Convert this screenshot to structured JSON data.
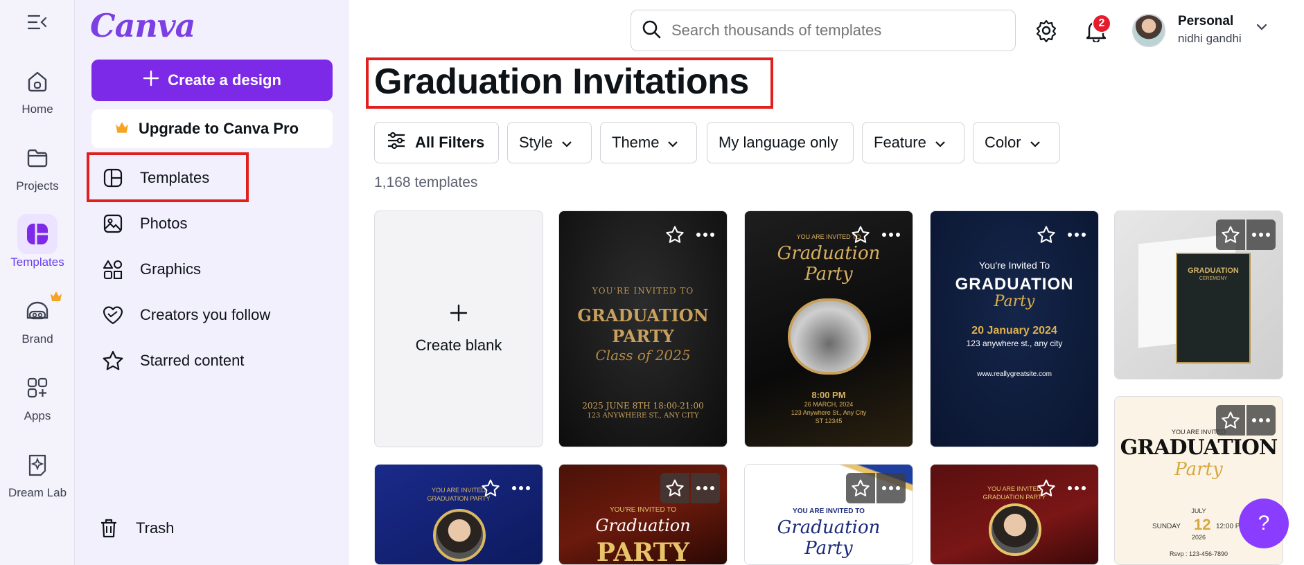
{
  "colors": {
    "brand": "#7d2ae8",
    "highlight": "#e0201d",
    "badge": "#e51c2c"
  },
  "rail": {
    "items": [
      {
        "label": "Home",
        "icon": "home-icon"
      },
      {
        "label": "Projects",
        "icon": "folder-icon"
      },
      {
        "label": "Templates",
        "icon": "templates-icon",
        "active": true
      },
      {
        "label": "Brand",
        "icon": "brand-icon"
      },
      {
        "label": "Apps",
        "icon": "apps-icon"
      },
      {
        "label": "Dream Lab",
        "icon": "dream-lab-icon"
      }
    ]
  },
  "panel": {
    "logo": "Canva",
    "create_label": "Create a design",
    "upgrade_label": "Upgrade to Canva Pro",
    "nav": [
      {
        "label": "Templates",
        "icon": "templates-icon"
      },
      {
        "label": "Photos",
        "icon": "photo-icon"
      },
      {
        "label": "Graphics",
        "icon": "shapes-icon"
      },
      {
        "label": "Creators you follow",
        "icon": "heart-icon"
      },
      {
        "label": "Starred content",
        "icon": "star-icon"
      }
    ],
    "trash_label": "Trash"
  },
  "header": {
    "search_placeholder": "Search thousands of templates",
    "notification_count": "2",
    "account_name": "Personal",
    "account_user": "nidhi gandhi"
  },
  "main": {
    "title": "Graduation Invitations",
    "filters": [
      {
        "label": "All Filters",
        "icon": "filters-icon"
      },
      {
        "label": "Style",
        "dropdown": true
      },
      {
        "label": "Theme",
        "dropdown": true
      },
      {
        "label": "My language only",
        "dropdown": false
      },
      {
        "label": "Feature",
        "dropdown": true
      },
      {
        "label": "Color",
        "dropdown": true
      }
    ],
    "count": "1,168 templates",
    "blank_label": "Create blank",
    "templates": [
      {
        "lines": [
          "YOU'RE INVITED TO",
          "GRADUATION",
          "PARTY",
          "Class of 2025",
          "2025 JUNE 8TH 18:00-21:00",
          "123 ANYWHERE ST., ANY CITY"
        ]
      },
      {
        "lines": [
          "YOU ARE INVITED TO",
          "Graduation",
          "Party",
          "8:00 PM",
          "26 MARCH, 2024",
          "123 Anywhere St., Any City",
          "ST 12345"
        ]
      },
      {
        "lines": [
          "You're Invited To",
          "GRADUATION",
          "Party",
          "20 January 2024",
          "123 anywhere st., any city",
          "www.reallygreatsite.com"
        ]
      },
      {
        "lines": [
          "GRADUATION",
          "CEREMONY"
        ]
      },
      {
        "lines": [
          "YOU ARE INVITED",
          "GRADUATION",
          "Party",
          "JULY",
          "SUNDAY",
          "12",
          "12:00 PM",
          "2026",
          "Rsvp : 123-456-7890"
        ]
      },
      {
        "lines": [
          "YOU ARE INVITED",
          "GRADUATION PARTY"
        ]
      },
      {
        "lines": [
          "YOU'RE INVITED TO",
          "Graduation",
          "PARTY"
        ]
      },
      {
        "lines": [
          "YOU ARE INVITED TO",
          "Graduation",
          "Party"
        ]
      },
      {
        "lines": [
          "YOU ARE INVITED",
          "GRADUATION PARTY"
        ]
      }
    ]
  },
  "help_label": "?"
}
